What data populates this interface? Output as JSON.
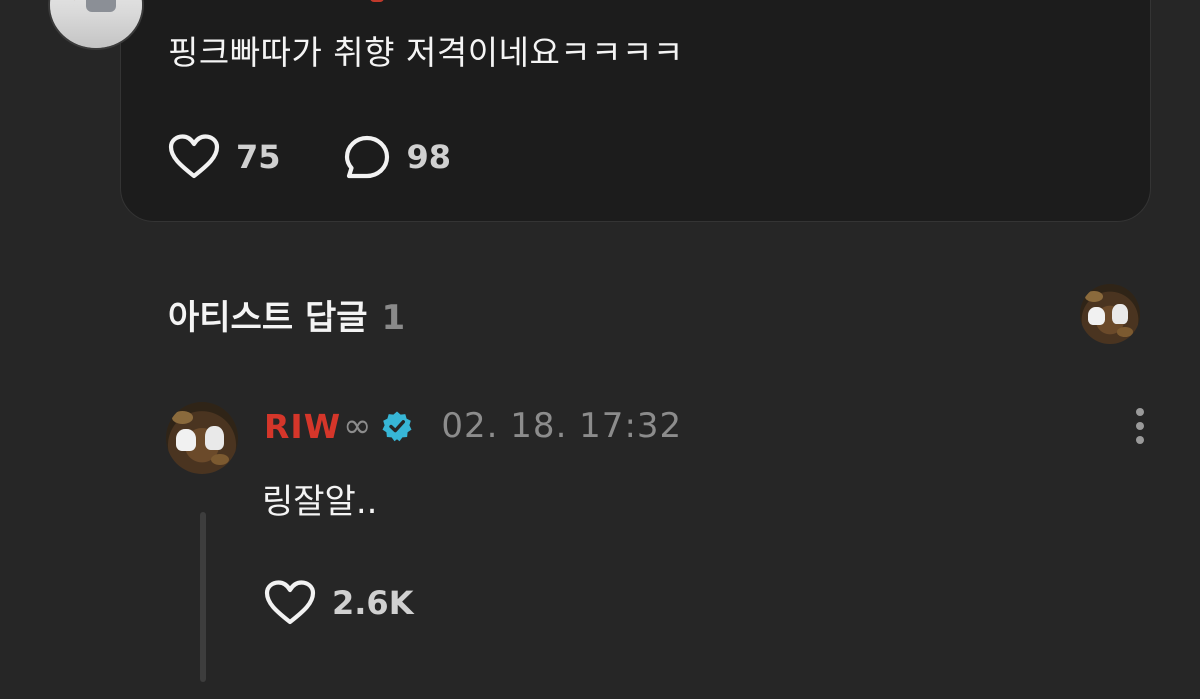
{
  "post": {
    "text": "핑크빠따가 취향 저격이네요ㅋㅋㅋㅋ",
    "like_count": "75",
    "comment_count": "98"
  },
  "artist_replies": {
    "title": "아티스트 답글",
    "count": "1"
  },
  "reply": {
    "author": "RIW",
    "author_suffix_icon": "infinity-icon",
    "verified_icon": "verified-badge-icon",
    "timestamp": "02. 18. 17:32",
    "text": "링잘알..",
    "like_count": "2.6K"
  },
  "colors": {
    "background": "#262626",
    "card_background": "#1c1c1c",
    "author_red": "#d5362a",
    "verified_blue": "#37b6d6",
    "muted_text": "#8c8c8c"
  }
}
